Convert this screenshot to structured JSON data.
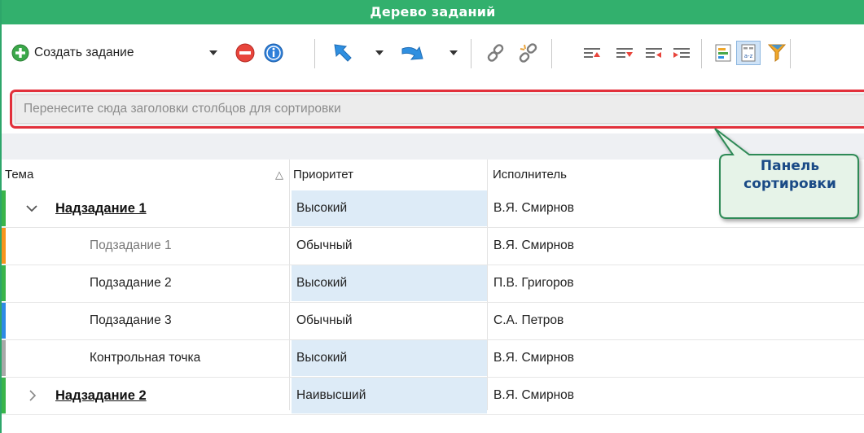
{
  "window": {
    "title": "Дерево заданий"
  },
  "toolbar": {
    "create_label": "Создать задание",
    "icons": [
      "create-task-icon",
      "dropdown-arrow-icon",
      "delete-icon",
      "info-icon",
      "arrow-up-left-icon",
      "arrow-down-right-icon",
      "link-icon",
      "unlink-icon",
      "expand-up-icon",
      "expand-down-icon",
      "collapse-left-icon",
      "expand-right-icon",
      "column-chooser-icon",
      "sort-panel-icon",
      "filter-icon"
    ]
  },
  "group_panel": {
    "placeholder": "Перенесите сюда заголовки столбцов для сортировки"
  },
  "callout": {
    "line1": "Панель",
    "line2": "сортировки"
  },
  "columns": {
    "subject": "Тема",
    "priority": "Приоритет",
    "assignee": "Исполнитель"
  },
  "rows": [
    {
      "subject": "Надзадание 1",
      "priority": "Высокий",
      "assignee": "В.Я. Смирнов",
      "level": 0,
      "expanded": true,
      "marker": "#39b54a"
    },
    {
      "subject": "Подзадание 1",
      "priority": "Обычный",
      "assignee": "В.Я. Смирнов",
      "level": 1,
      "marker": "#f7941d"
    },
    {
      "subject": "Подзадание 2",
      "priority": "Высокий",
      "assignee": "П.В. Григоров",
      "level": 1,
      "marker": "#39b54a"
    },
    {
      "subject": "Подзадание 3",
      "priority": "Обычный",
      "assignee": "С.А. Петров",
      "level": 1,
      "marker": "#2e8ae6"
    },
    {
      "subject": "Контрольная точка",
      "priority": "Высокий",
      "assignee": "В.Я. Смирнов",
      "level": 1,
      "marker": "#a8a8a8"
    },
    {
      "subject": "Надзадание 2",
      "priority": "Наивысший",
      "assignee": "В.Я. Смирнов",
      "level": 0,
      "expanded": false,
      "marker": "#39b54a"
    }
  ],
  "colors": {
    "title_bar": "#32b06d",
    "highlight_border": "#e2303b",
    "priority_high_bg": "#ddebf7",
    "callout_fill": "#e6f3e8",
    "callout_text": "#1a4a86"
  }
}
